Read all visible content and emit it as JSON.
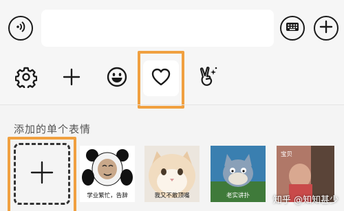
{
  "section": {
    "title": "添加的单个表情"
  },
  "stickers": [
    {
      "caption": "学业繁忙，告辞"
    },
    {
      "caption": "我又不敢顶嘴"
    },
    {
      "caption": "老实讲扑"
    },
    {
      "caption": "宝贝"
    }
  ],
  "watermark": "知乎 @知知甚少",
  "icons": {
    "voice": "voice-icon",
    "keyboard": "keyboard-icon",
    "more": "plus-circle-icon",
    "settings": "gear-icon",
    "add": "plus-icon",
    "emoji": "smiley-icon",
    "favorite": "heart-icon",
    "gesture": "peace-hand-icon"
  },
  "colors": {
    "highlight": "#f0a040",
    "background": "#f4f4f4",
    "selected_bg": "#ffffff"
  }
}
